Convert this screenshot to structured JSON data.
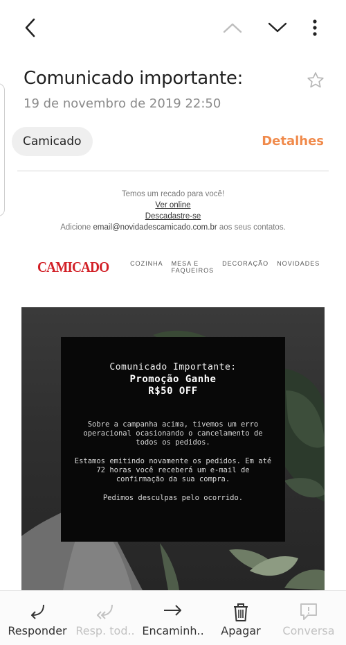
{
  "header": {
    "back_icon": "chevron-left-icon",
    "prev_icon": "chevron-up-icon",
    "next_icon": "chevron-down-icon",
    "more_icon": "vertical-dots-icon"
  },
  "email": {
    "subject": "Comunicado importante:",
    "date": "19 de novembro de 2019  22:50",
    "sender": "Camicado",
    "details_label": "Detalhes",
    "details_color": "#f08a4b"
  },
  "body": {
    "preheader": {
      "line1": "Temos um recado para você!",
      "view_online": "Ver online",
      "unsubscribe": "Descadastre-se",
      "add_prefix": "Adicione ",
      "add_email": "email@novidadescamicado.com.br",
      "add_suffix": " aos seus contatos."
    },
    "brand": {
      "logo_text": "CAMICADO",
      "logo_color": "#d21f26",
      "nav": [
        "COZINHA",
        "MESA E FAQUEIROS",
        "DECORAÇÃO",
        "NOVIDADES"
      ]
    },
    "notice": {
      "title": "Comunicado Importante:",
      "promo_line1": "Promoção Ganhe",
      "promo_line2": "R$50 OFF",
      "paragraph1": "Sobre a campanha acima, tivemos um erro operacional ocasionando o cancelamento de todos os pedidos.",
      "paragraph2": "Estamos emitindo novamente os pedidos. Em até 72 horas você receberá um e-mail de confirmação da sua compra.",
      "paragraph3": "Pedimos desculpas pelo ocorrido."
    }
  },
  "toolbar": {
    "items": [
      {
        "label": "Responder",
        "icon": "reply-icon",
        "enabled": true
      },
      {
        "label": "Resp. tod..",
        "icon": "reply-all-icon",
        "enabled": false
      },
      {
        "label": "Encaminh..",
        "icon": "forward-icon",
        "enabled": true
      },
      {
        "label": "Apagar",
        "icon": "trash-icon",
        "enabled": true
      },
      {
        "label": "Conversa",
        "icon": "conversation-icon",
        "enabled": false
      }
    ]
  }
}
